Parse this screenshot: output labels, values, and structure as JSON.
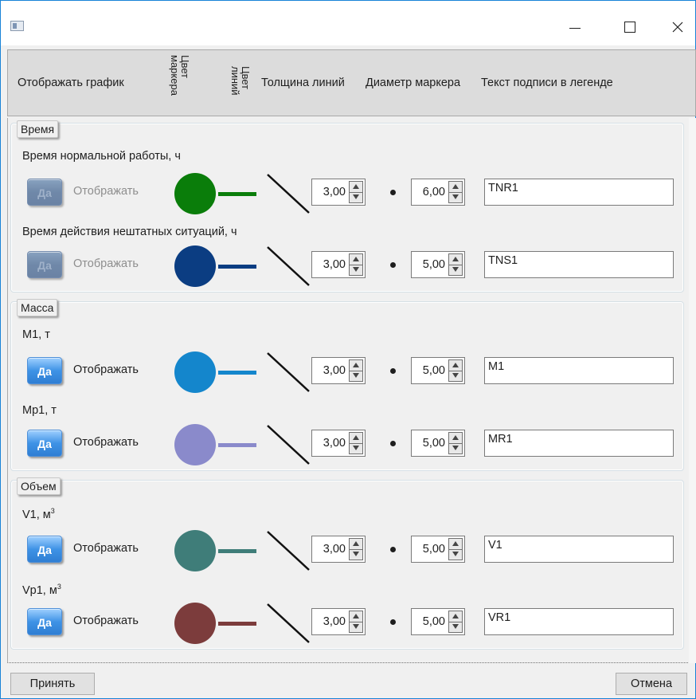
{
  "window": {
    "title": ""
  },
  "header": {
    "show_graph": "Отображать график",
    "marker_color": "Цвет\nмаркера",
    "line_color": "Цвет\nлиний",
    "line_thickness": "Толщина линий",
    "marker_diameter": "Диаметр маркера",
    "legend_text": "Текст подписи в легенде"
  },
  "groups": [
    {
      "title": "Время",
      "rows": [
        {
          "label": "Время нормальной работы, ч",
          "toggle": "Да",
          "toggle_text": "Отображать",
          "enabled": false,
          "color": "#0a7d0a",
          "thickness": "3,00",
          "diameter": "6,00",
          "legend": "TNR1"
        },
        {
          "label": "Время действия нештатных ситуаций, ч",
          "toggle": "Да",
          "toggle_text": "Отображать",
          "enabled": false,
          "color": "#0b3d82",
          "thickness": "3,00",
          "diameter": "5,00",
          "legend": "TNS1"
        }
      ]
    },
    {
      "title": "Масса",
      "rows": [
        {
          "label": "M1, т",
          "toggle": "Да",
          "toggle_text": "Отображать",
          "enabled": true,
          "color": "#1486cc",
          "thickness": "3,00",
          "diameter": "5,00",
          "legend": "M1"
        },
        {
          "label": "Mp1, т",
          "toggle": "Да",
          "toggle_text": "Отображать",
          "enabled": true,
          "color": "#8a8acb",
          "thickness": "3,00",
          "diameter": "5,00",
          "legend": "MR1"
        }
      ]
    },
    {
      "title": "Объем",
      "rows": [
        {
          "label": "V1, м",
          "label_sup": "3",
          "toggle": "Да",
          "toggle_text": "Отображать",
          "enabled": true,
          "color": "#3f7d79",
          "thickness": "3,00",
          "diameter": "5,00",
          "legend": "V1"
        },
        {
          "label": "Vp1, м",
          "label_sup": "3",
          "toggle": "Да",
          "toggle_text": "Отображать",
          "enabled": true,
          "color": "#7c3c3c",
          "thickness": "3,00",
          "diameter": "5,00",
          "legend": "VR1"
        }
      ]
    }
  ],
  "footer": {
    "accept": "Принять",
    "cancel": "Отмена"
  }
}
